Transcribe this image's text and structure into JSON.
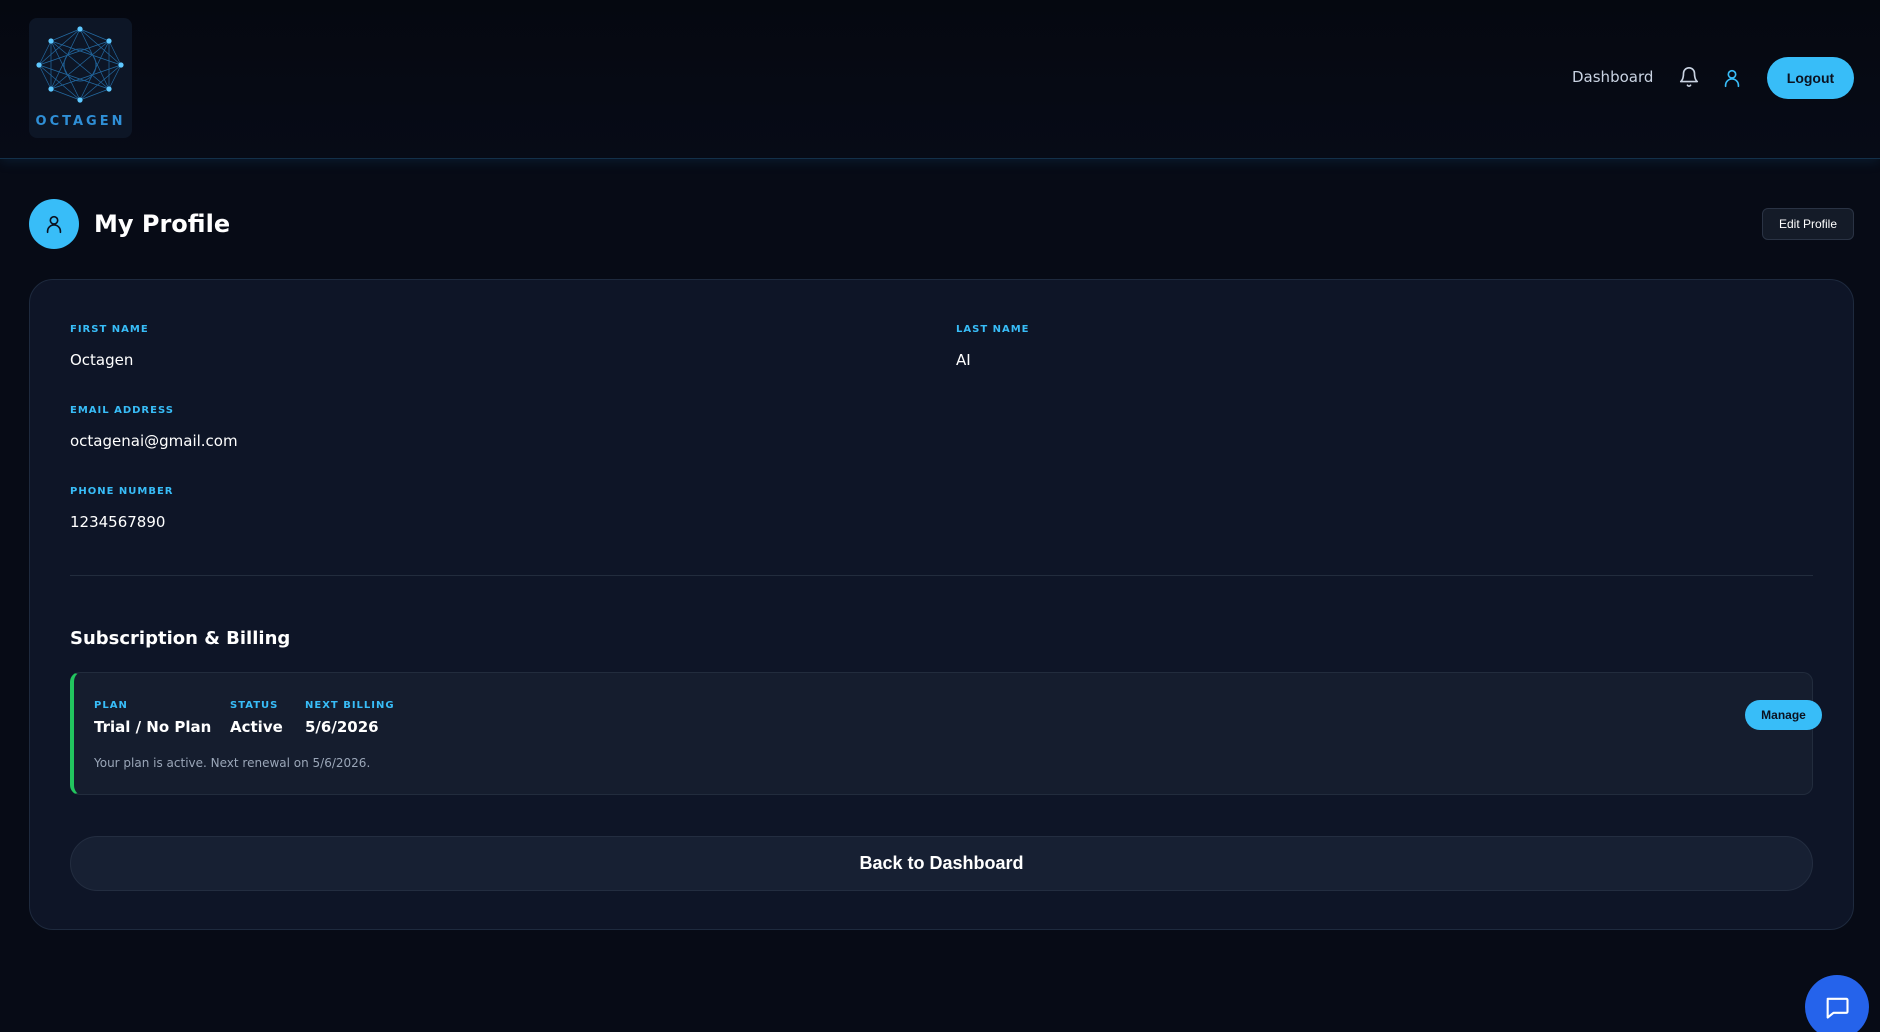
{
  "brand": {
    "name": "OCTAGEN"
  },
  "header": {
    "nav_dashboard": "Dashboard",
    "icons": [
      "bell-icon",
      "user-icon"
    ],
    "logout_label": "Logout"
  },
  "page": {
    "title": "My Profile",
    "edit_label": "Edit Profile",
    "icon": "user-icon"
  },
  "profile": {
    "first_name_label": "FIRST NAME",
    "first_name": "Octagen",
    "last_name_label": "LAST NAME",
    "last_name": "AI",
    "email_label": "EMAIL ADDRESS",
    "email": "octagenai@gmail.com",
    "phone_label": "PHONE NUMBER",
    "phone": "1234567890"
  },
  "subscription": {
    "title": "Subscription & Billing",
    "plan_label": "PLAN",
    "plan": "Trial / No Plan",
    "status_label": "STATUS",
    "status": "Active",
    "next_billing_label": "NEXT BILLING",
    "next_billing": "5/6/2026",
    "note": "Your plan is active. Next renewal on 5/6/2026.",
    "manage_label": "Manage"
  },
  "back_label": "Back to Dashboard",
  "colors": {
    "accent": "#38bdf8",
    "status_active": "#22c55e",
    "chat": "#2563eb",
    "background": "#070b16"
  }
}
